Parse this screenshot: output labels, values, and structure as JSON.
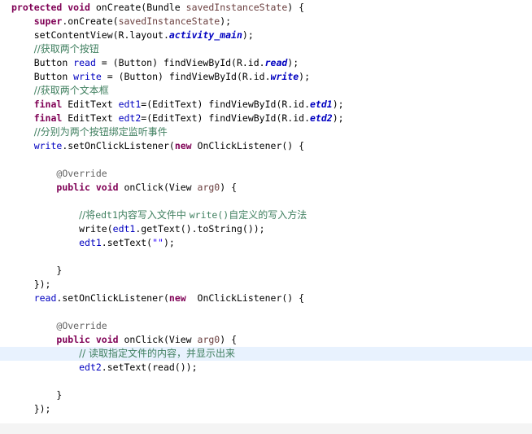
{
  "editor": {
    "lines": [
      {
        "indent": "",
        "tokens": [
          {
            "t": "protected",
            "c": "kw"
          },
          {
            "t": " ",
            "c": "plain"
          },
          {
            "t": "void",
            "c": "kw"
          },
          {
            "t": " onCreate(Bundle ",
            "c": "plain"
          },
          {
            "t": "savedInstanceState",
            "c": "param"
          },
          {
            "t": ") {",
            "c": "plain"
          }
        ]
      },
      {
        "indent": "    ",
        "tokens": [
          {
            "t": "super",
            "c": "kw"
          },
          {
            "t": ".onCreate(",
            "c": "plain"
          },
          {
            "t": "savedInstanceState",
            "c": "param"
          },
          {
            "t": ");",
            "c": "plain"
          }
        ]
      },
      {
        "indent": "    ",
        "tokens": [
          {
            "t": "setContentView(R.layout.",
            "c": "plain"
          },
          {
            "t": "activity_main",
            "c": "sfield"
          },
          {
            "t": ");",
            "c": "plain"
          }
        ]
      },
      {
        "indent": "    ",
        "tokens": [
          {
            "t": "//获取两个按钮",
            "c": "cmt"
          }
        ]
      },
      {
        "indent": "    ",
        "tokens": [
          {
            "t": "Button ",
            "c": "plain"
          },
          {
            "t": "read",
            "c": "field"
          },
          {
            "t": " = (Button) findViewById(R.id.",
            "c": "plain"
          },
          {
            "t": "read",
            "c": "sfield"
          },
          {
            "t": ");",
            "c": "plain"
          }
        ]
      },
      {
        "indent": "    ",
        "tokens": [
          {
            "t": "Button ",
            "c": "plain"
          },
          {
            "t": "write",
            "c": "field"
          },
          {
            "t": " = (Button) findViewById(R.id.",
            "c": "plain"
          },
          {
            "t": "write",
            "c": "sfield"
          },
          {
            "t": ");",
            "c": "plain"
          }
        ]
      },
      {
        "indent": "    ",
        "tokens": [
          {
            "t": "//获取两个文本框",
            "c": "cmt"
          }
        ]
      },
      {
        "indent": "    ",
        "tokens": [
          {
            "t": "final",
            "c": "kw"
          },
          {
            "t": " EditText ",
            "c": "plain"
          },
          {
            "t": "edt1",
            "c": "field"
          },
          {
            "t": "=(EditText) findViewById(R.id.",
            "c": "plain"
          },
          {
            "t": "etd1",
            "c": "sfield"
          },
          {
            "t": ");",
            "c": "plain"
          }
        ]
      },
      {
        "indent": "    ",
        "tokens": [
          {
            "t": "final",
            "c": "kw"
          },
          {
            "t": " EditText ",
            "c": "plain"
          },
          {
            "t": "edt2",
            "c": "field"
          },
          {
            "t": "=(EditText) findViewById(R.id.",
            "c": "plain"
          },
          {
            "t": "etd2",
            "c": "sfield"
          },
          {
            "t": ");",
            "c": "plain"
          }
        ]
      },
      {
        "indent": "    ",
        "tokens": [
          {
            "t": "//分别为两个按钮绑定监听事件",
            "c": "cmt"
          }
        ]
      },
      {
        "indent": "    ",
        "tokens": [
          {
            "t": "write",
            "c": "field"
          },
          {
            "t": ".setOnClickListener(",
            "c": "plain"
          },
          {
            "t": "new",
            "c": "kw"
          },
          {
            "t": " OnClickListener() {",
            "c": "plain"
          }
        ]
      },
      {
        "indent": "",
        "tokens": []
      },
      {
        "indent": "        ",
        "tokens": [
          {
            "t": "@Override",
            "c": "ann"
          }
        ]
      },
      {
        "indent": "        ",
        "tokens": [
          {
            "t": "public",
            "c": "kw"
          },
          {
            "t": " ",
            "c": "plain"
          },
          {
            "t": "void",
            "c": "kw"
          },
          {
            "t": " onClick(View ",
            "c": "plain"
          },
          {
            "t": "arg0",
            "c": "param"
          },
          {
            "t": ") {",
            "c": "plain"
          }
        ]
      },
      {
        "indent": "",
        "tokens": []
      },
      {
        "indent": "            ",
        "tokens": [
          {
            "t": "//将",
            "c": "cmt"
          },
          {
            "t": "edt1",
            "c": "cmt-code"
          },
          {
            "t": "内容写入文件中 ",
            "c": "cmt"
          },
          {
            "t": "write()",
            "c": "cmt-code"
          },
          {
            "t": "自定义的写入方法",
            "c": "cmt"
          }
        ]
      },
      {
        "indent": "            ",
        "tokens": [
          {
            "t": "write(",
            "c": "plain"
          },
          {
            "t": "edt1",
            "c": "field"
          },
          {
            "t": ".getText().toString());",
            "c": "plain"
          }
        ]
      },
      {
        "indent": "            ",
        "tokens": [
          {
            "t": "edt1",
            "c": "field"
          },
          {
            "t": ".setText(",
            "c": "plain"
          },
          {
            "t": "\"\"",
            "c": "str"
          },
          {
            "t": ");",
            "c": "plain"
          }
        ]
      },
      {
        "indent": "",
        "tokens": []
      },
      {
        "indent": "        ",
        "tokens": [
          {
            "t": "}",
            "c": "plain"
          }
        ]
      },
      {
        "indent": "    ",
        "tokens": [
          {
            "t": "});",
            "c": "plain"
          }
        ]
      },
      {
        "indent": "    ",
        "tokens": [
          {
            "t": "read",
            "c": "field"
          },
          {
            "t": ".setOnClickListener(",
            "c": "plain"
          },
          {
            "t": "new",
            "c": "kw"
          },
          {
            "t": "  OnClickListener() {",
            "c": "plain"
          }
        ]
      },
      {
        "indent": "",
        "tokens": []
      },
      {
        "indent": "        ",
        "tokens": [
          {
            "t": "@Override",
            "c": "ann"
          }
        ]
      },
      {
        "indent": "        ",
        "tokens": [
          {
            "t": "public",
            "c": "kw"
          },
          {
            "t": " ",
            "c": "plain"
          },
          {
            "t": "void",
            "c": "kw"
          },
          {
            "t": " onClick(View ",
            "c": "plain"
          },
          {
            "t": "arg0",
            "c": "param"
          },
          {
            "t": ") {",
            "c": "plain"
          }
        ]
      },
      {
        "indent": "            ",
        "highlight": true,
        "tokens": [
          {
            "t": "// 读取指定文件的内容，并显示出来",
            "c": "cmt"
          }
        ]
      },
      {
        "indent": "            ",
        "tokens": [
          {
            "t": "edt2",
            "c": "field"
          },
          {
            "t": ".setText(read());",
            "c": "plain"
          }
        ]
      },
      {
        "indent": "",
        "tokens": []
      },
      {
        "indent": "        ",
        "tokens": [
          {
            "t": "}",
            "c": "plain"
          }
        ]
      },
      {
        "indent": "    ",
        "tokens": [
          {
            "t": "});",
            "c": "plain"
          }
        ]
      }
    ]
  }
}
